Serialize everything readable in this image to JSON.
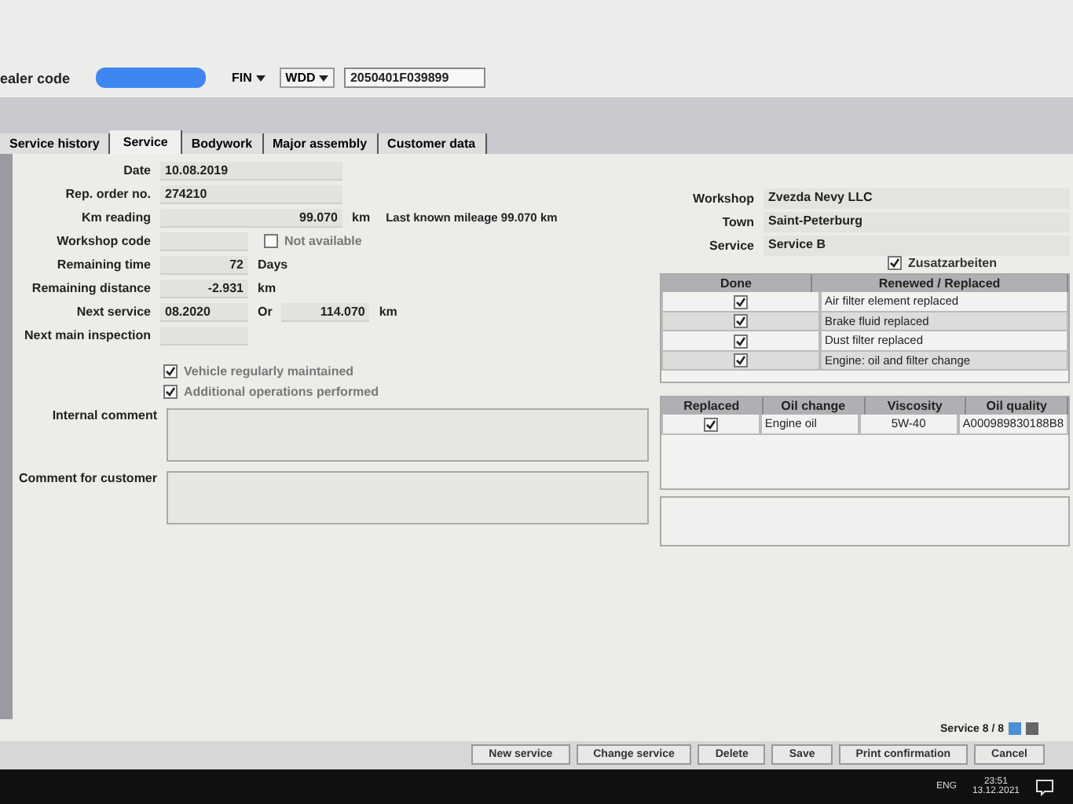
{
  "header": {
    "dealer_code_label": "ealer code",
    "fin_dropdown": "FIN",
    "prefix_dropdown": "WDD",
    "fin_value": "2050401F039899"
  },
  "tabs": [
    {
      "label": "Service history",
      "selected": false
    },
    {
      "label": "Service",
      "selected": true
    },
    {
      "label": "Bodywork",
      "selected": false
    },
    {
      "label": "Major assembly",
      "selected": false
    },
    {
      "label": "Customer data",
      "selected": false
    }
  ],
  "fields": [
    {
      "label": "Date",
      "items": [
        {
          "kind": "value",
          "text": "10.08.2019"
        }
      ]
    },
    {
      "label": "Rep. order no.",
      "items": [
        {
          "kind": "value",
          "text": "274210"
        }
      ]
    },
    {
      "label": "Km reading",
      "items": [
        {
          "kind": "number",
          "text": "99.070"
        },
        {
          "kind": "unit",
          "text": "km"
        },
        {
          "kind": "note",
          "text": "Last known mileage 99.070 km"
        }
      ]
    },
    {
      "label": "Workshop code",
      "items": [
        {
          "kind": "blank"
        },
        {
          "kind": "checkbox",
          "text": "Not available",
          "checked": false
        }
      ]
    },
    {
      "label": "Remaining time",
      "items": [
        {
          "kind": "count",
          "text": "72"
        },
        {
          "kind": "unit",
          "text": "Days"
        }
      ]
    },
    {
      "label": "Remaining distance",
      "items": [
        {
          "kind": "count",
          "text": "-2.931"
        },
        {
          "kind": "unit",
          "text": "km"
        }
      ]
    },
    {
      "label": "Next service",
      "items": [
        {
          "kind": "month",
          "text": "08.2020"
        },
        {
          "kind": "unit",
          "text": "Or"
        },
        {
          "kind": "count",
          "text": "114.070"
        },
        {
          "kind": "unit",
          "text": "km"
        }
      ]
    },
    {
      "label": "Next main inspection",
      "items": [
        {
          "kind": "blank"
        }
      ]
    }
  ],
  "options": [
    {
      "label": "Vehicle regularly maintained",
      "checked": true
    },
    {
      "label": "Additional operations performed",
      "checked": true
    }
  ],
  "comments": [
    {
      "label": "Internal comment"
    },
    {
      "label": "Comment for customer"
    }
  ],
  "workshop": [
    {
      "label": "Workshop",
      "value": "Zvezda Nevy LLC"
    },
    {
      "label": "Town",
      "value": "Saint-Peterburg"
    },
    {
      "label": "Service",
      "value": "Service B"
    }
  ],
  "extra_work": {
    "label": "Zusatzarbeiten",
    "checked": true
  },
  "work_table": {
    "columns": [
      "Done",
      "Renewed / Replaced"
    ],
    "rows": [
      {
        "done": true,
        "text": "Air filter element replaced"
      },
      {
        "done": true,
        "text": "Brake fluid replaced"
      },
      {
        "done": true,
        "text": "Dust filter replaced"
      },
      {
        "done": true,
        "text": "Engine: oil and filter change"
      }
    ]
  },
  "oil_table": {
    "columns": [
      "Replaced",
      "Oil change",
      "Viscosity",
      "Oil quality"
    ],
    "rows": [
      {
        "replaced": true,
        "oil_change": "Engine oil",
        "viscosity": "5W-40",
        "oil_quality": "A000989830188B8"
      }
    ]
  },
  "pager": "Service 8 / 8",
  "buttons": [
    "New service",
    "Change service",
    "Delete",
    "Save",
    "Print confirmation",
    "Cancel"
  ],
  "taskbar": {
    "language": "ENG",
    "time": "23:51",
    "date": "13.12.2021"
  }
}
